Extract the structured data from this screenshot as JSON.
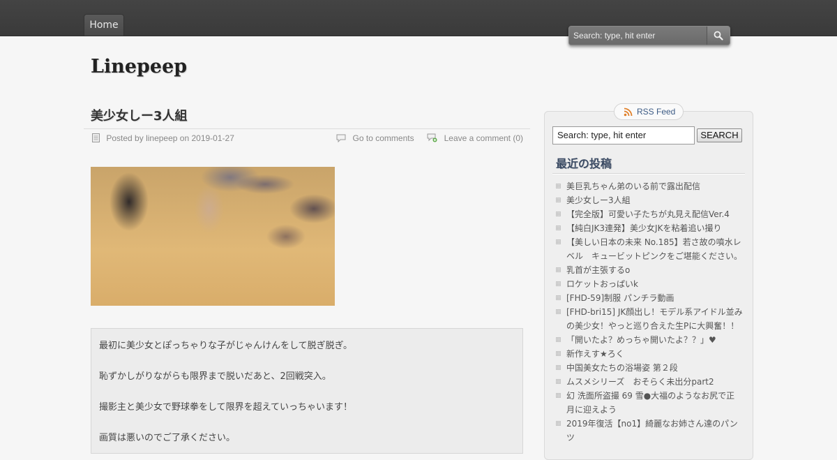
{
  "nav": {
    "home_label": "Home"
  },
  "top_search": {
    "placeholder": "Search: type, hit enter"
  },
  "site": {
    "title": "Linepeep"
  },
  "post": {
    "title": "美少女しー3人組",
    "meta": {
      "posted_by_prefix": "Posted by",
      "author": "linepeep",
      "date_prefix": "on",
      "date": "2019-01-27",
      "comments_link": "Go to comments",
      "leave_comment": "Leave a comment (0)"
    },
    "body": [
      "最初に美少女とぽっちゃりな子がじゃんけんをして脱ぎ脱ぎ。",
      "恥ずかしがりながらも限界まで脱いだあと、2回戦突入。",
      "撮影主と美少女で野球拳をして限界を超えていっちゃいます！",
      "画質は悪いのでご了承ください。"
    ]
  },
  "sidebar": {
    "rss_label": "RSS Feed",
    "search_value": "Search: type, hit enter",
    "search_button": "SEARCH",
    "recent_title": "最近の投稿",
    "recent_posts": [
      "美巨乳ちゃん弟のいる前で露出配信",
      "美少女しー3人組",
      "【完全版】可愛い子たちが丸見え配信Ver.4",
      "【純白JK3連発】美少女JKを粘着追い撮り",
      "【美しい日本の未来 No.185】若さ故の噴水レベル　キュービットピンクをご堪能ください。",
      "乳首が主張するo",
      "ロケットおっぱいk",
      "[FHD-59]制服 パンチラ動画",
      "[FHD-bri15] JK顔出し！モデル系アイドル並みの美少女！やっと巡り合えた生Pに大興奮！！",
      "「開いたよ？めっちゃ開いたよ？？」♥",
      "新作えす★ろく",
      "中国美女たちの浴場姿 第２段",
      "ムスメシリーズ　おそらく未出分part2",
      "幻 洗面所盗撮 69 雪●大福のようなお尻で正月に迎えよう",
      "2019年復活【no1】綺麗なお姉さん達のパンツ"
    ]
  },
  "icons": {
    "search": "magnifier-icon",
    "rss": "rss-icon",
    "meta_post": "document-icon",
    "meta_comments": "speech-bubble-icon",
    "meta_leave_comment": "comment-add-icon"
  }
}
